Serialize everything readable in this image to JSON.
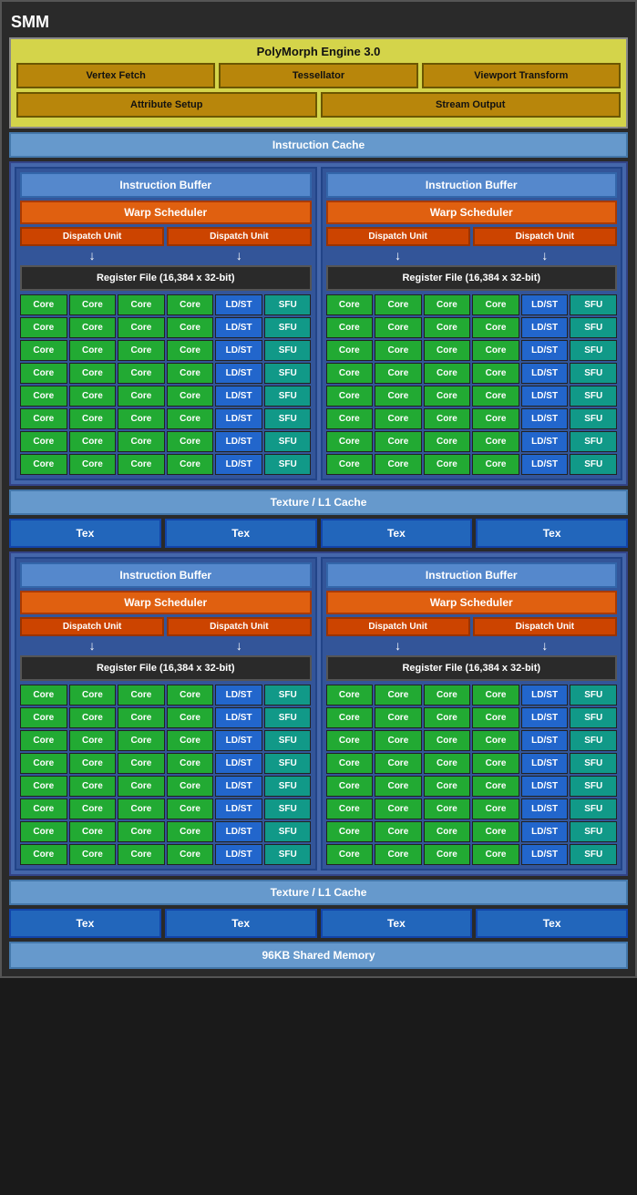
{
  "title": "SMM",
  "polymorph": {
    "title": "PolyMorph Engine 3.0",
    "row1": [
      "Vertex Fetch",
      "Tessellator",
      "Viewport Transform"
    ],
    "row2": [
      "Attribute Setup",
      "Stream Output"
    ]
  },
  "instruction_cache": "Instruction Cache",
  "sections": [
    {
      "instruction_buffer": "Instruction Buffer",
      "warp_scheduler": "Warp Scheduler",
      "dispatch_units": [
        "Dispatch Unit",
        "Dispatch Unit"
      ],
      "register_file": "Register File (16,384 x 32-bit)",
      "rows": 8,
      "core_row": [
        "Core",
        "Core",
        "Core",
        "Core",
        "LD/ST",
        "SFU"
      ]
    },
    {
      "instruction_buffer": "Instruction Buffer",
      "warp_scheduler": "Warp Scheduler",
      "dispatch_units": [
        "Dispatch Unit",
        "Dispatch Unit"
      ],
      "register_file": "Register File (16,384 x 32-bit)",
      "rows": 8,
      "core_row": [
        "Core",
        "Core",
        "Core",
        "Core",
        "LD/ST",
        "SFU"
      ]
    }
  ],
  "texture_cache": "Texture / L1 Cache",
  "tex_labels": [
    "Tex",
    "Tex",
    "Tex",
    "Tex"
  ],
  "shared_memory": "96KB Shared Memory"
}
